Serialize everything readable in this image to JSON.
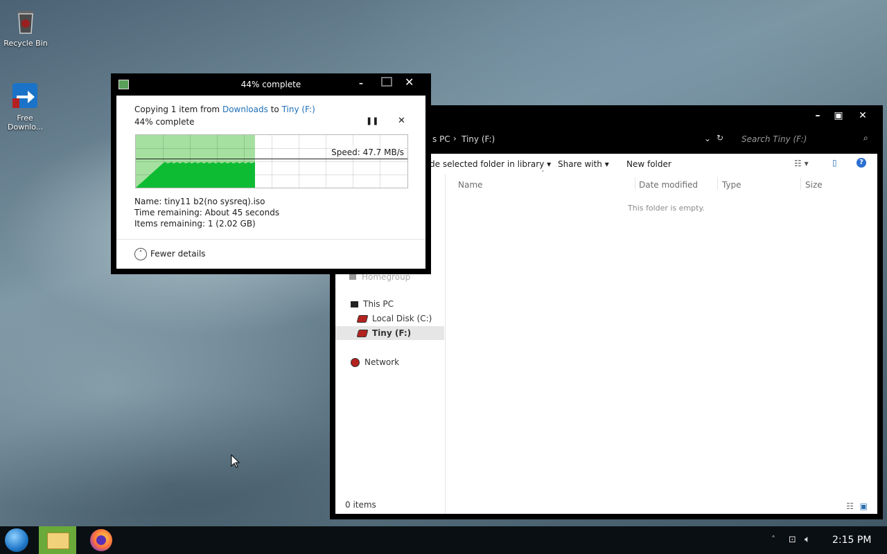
{
  "desktop": {
    "icons": [
      {
        "label": "Recycle Bin"
      },
      {
        "label": "Free Downlo..."
      }
    ]
  },
  "copy_dialog": {
    "title": "44% complete",
    "copying_prefix": "Copying 1 item from",
    "source": "Downloads",
    "to_word": "to",
    "destination": "Tiny (F:)",
    "percent_text": "44% complete",
    "progress_fraction": 0.44,
    "speed": "Speed: 47.7 MB/s",
    "name_label": "Name:",
    "name_value": "tiny11 b2(no sysreq).iso",
    "time_label": "Time remaining:",
    "time_value": "About 45 seconds",
    "items_label": "Items remaining:",
    "items_value": "1 (2.02 GB)",
    "fewer_details": "Fewer details",
    "colors": {
      "graph_fill": "#a5e0a0",
      "graph_curve": "#0ebc33"
    }
  },
  "explorer": {
    "address_crumb_1": "s PC",
    "address_sep": "›",
    "address_crumb_2": "Tiny (F:)",
    "search_placeholder": "Search Tiny (F:)",
    "toolbar": {
      "include_library": "de selected folder in library",
      "share_with": "Share with",
      "new_folder": "New folder"
    },
    "columns": [
      "Name",
      "Date modified",
      "Type",
      "Size"
    ],
    "empty_message": "This folder is empty.",
    "nav": {
      "homegroup": "Homegroup",
      "this_pc": "This PC",
      "local_disk": "Local Disk (C:)",
      "tiny": "Tiny (F:)",
      "network": "Network"
    },
    "status": "0 items"
  },
  "taskbar": {
    "clock": "2:15 PM"
  }
}
